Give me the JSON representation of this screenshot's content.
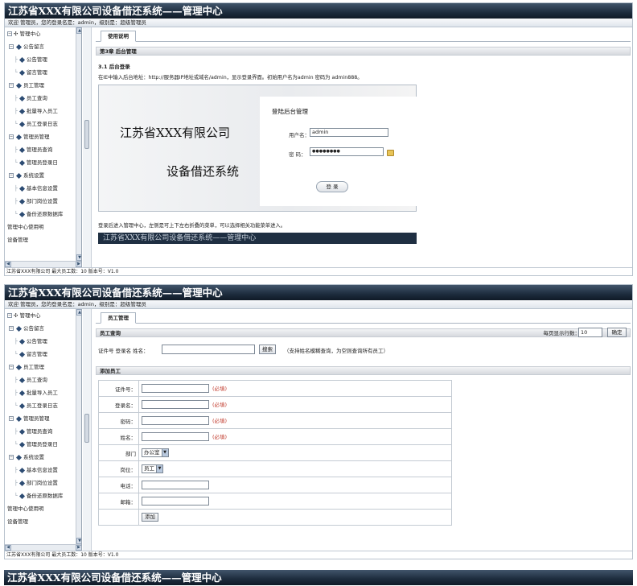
{
  "app_title": "江苏省XXX有限公司设备借还系统——管理中心",
  "info_bar": "欢迎 管理员，您的登录名是：admin，级别是：超级管理员",
  "footer": "江苏省XXX有限公司 最大员工数：10 版本号：V1.0",
  "sidebar": {
    "items": [
      {
        "label": "管理中心"
      },
      {
        "label": "公告留言"
      },
      {
        "label": "公告管理"
      },
      {
        "label": "留言管理"
      },
      {
        "label": "员工管理"
      },
      {
        "label": "员工查询"
      },
      {
        "label": "批量导入员工"
      },
      {
        "label": "员工登录日志"
      },
      {
        "label": "管理员管理"
      },
      {
        "label": "管理员查询"
      },
      {
        "label": "管理员登录日"
      },
      {
        "label": "系统设置"
      },
      {
        "label": "基本信息设置"
      },
      {
        "label": "部门岗位设置"
      },
      {
        "label": "备份还原数据库"
      },
      {
        "label": "管理中心使用明"
      },
      {
        "label": "设备管理"
      }
    ]
  },
  "panel1": {
    "tab_label": "使用说明",
    "chapter_title": "第3章 后台管理",
    "section_title": "3.1 后台登录",
    "intro_text": "在IE中输入后台地址：http://服务器IP地址或域名/admin，显示登录界面。初始用户名为admin 密码为 admin888。",
    "login_image": {
      "company": "江苏省XXX有限公司",
      "system": "设备借还系统",
      "login_title": "登陆后台管理",
      "username_label": "用户名：",
      "username_value": "admin",
      "password_label": "密  码：",
      "password_value": "●●●●●●●●",
      "login_button": "登 录"
    },
    "after_text": "登录后进入管理中心，左侧是可上下左右折叠的菜单，可以选择相关功能菜单进入。",
    "dark_strip_text": "江苏省XXX有限公司设备借还系统——管理中心"
  },
  "panel2": {
    "tab_label": "员工管理",
    "query_section": "员工查询",
    "rows_per_page_label": "每页显示行数：",
    "rows_per_page_value": "10",
    "confirm_button": "确定",
    "search_label": "证件号 登录名 姓名：",
    "search_button": "搜索",
    "search_hint": "（支持姓名模糊查询，为空则查询所有员工）",
    "add_section": "添加员工",
    "fields": [
      {
        "label": "证件号：",
        "required": "(必填)"
      },
      {
        "label": "登录名：",
        "required": "(必填)"
      },
      {
        "label": "密码：",
        "required": "(必填)"
      },
      {
        "label": "姓名：",
        "required": "(必填)"
      }
    ],
    "dept_label": "部门",
    "dept_value": "办公室",
    "post_label": "岗位：",
    "post_value": "员工",
    "phone_label": "电话：",
    "email_label": "邮箱：",
    "add_button": "添加"
  },
  "panel3": {
    "title": "江苏省XXX有限公司设备借还系统——管理中心"
  }
}
